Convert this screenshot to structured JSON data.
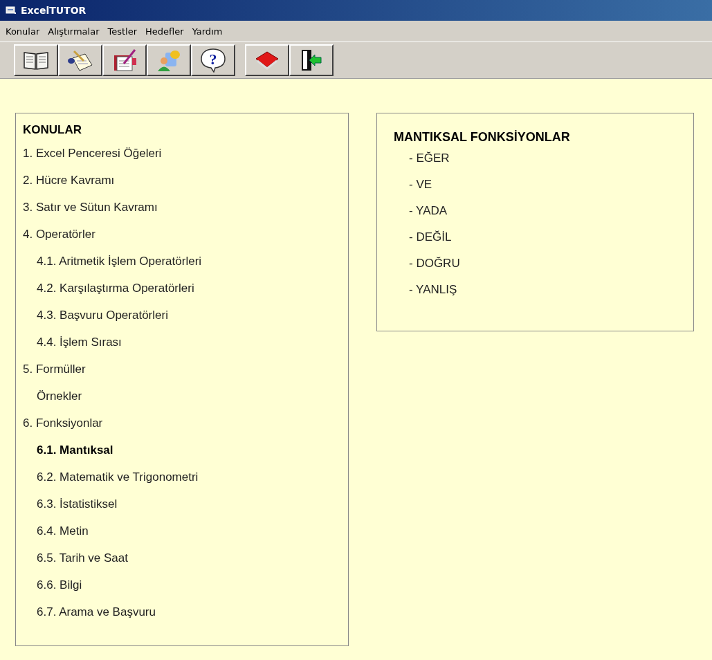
{
  "window": {
    "title": "ExcelTUTOR"
  },
  "menu": [
    "Konular",
    "Alıştırmalar",
    "Testler",
    "Hedefler",
    "Yardım"
  ],
  "toolbar": [
    {
      "kind": "book"
    },
    {
      "kind": "notepad"
    },
    {
      "kind": "writing"
    },
    {
      "kind": "people"
    },
    {
      "kind": "help",
      "glyph": "?"
    },
    {
      "kind": "gap"
    },
    {
      "kind": "redbook"
    },
    {
      "kind": "exit"
    }
  ],
  "topics": {
    "heading": "KONULAR",
    "items": [
      {
        "label": "1. Excel Penceresi Öğeleri",
        "selected": false
      },
      {
        "label": "2. Hücre Kavramı",
        "selected": false
      },
      {
        "label": "3. Satır ve Sütun Kavramı",
        "selected": false
      },
      {
        "label": "4. Operatörler",
        "selected": false,
        "children": [
          {
            "label": "4.1. Aritmetik İşlem Operatörleri",
            "selected": false
          },
          {
            "label": "4.2. Karşılaştırma Operatörleri",
            "selected": false
          },
          {
            "label": "4.3. Başvuru Operatörleri",
            "selected": false
          },
          {
            "label": "4.4. İşlem Sırası",
            "selected": false
          }
        ]
      },
      {
        "label": "5. Formüller",
        "selected": false,
        "children": [
          {
            "label": "Örnekler",
            "selected": false
          }
        ]
      },
      {
        "label": "6. Fonksiyonlar",
        "selected": false,
        "children": [
          {
            "label": "6.1. Mantıksal",
            "selected": true
          },
          {
            "label": "6.2. Matematik ve Trigonometri",
            "selected": false
          },
          {
            "label": "6.3. İstatistiksel",
            "selected": false
          },
          {
            "label": "6.4. Metin",
            "selected": false
          },
          {
            "label": "6.5. Tarih ve Saat",
            "selected": false
          },
          {
            "label": "6.6. Bilgi",
            "selected": false
          },
          {
            "label": "6.7. Arama ve Başvuru",
            "selected": false
          }
        ]
      }
    ]
  },
  "detail": {
    "heading": "MANTIKSAL FONKSİYONLAR",
    "items": [
      "- EĞER",
      "- VE",
      "- YADA",
      "- DEĞİL",
      "- DOĞRU",
      "- YANLIŞ"
    ]
  }
}
